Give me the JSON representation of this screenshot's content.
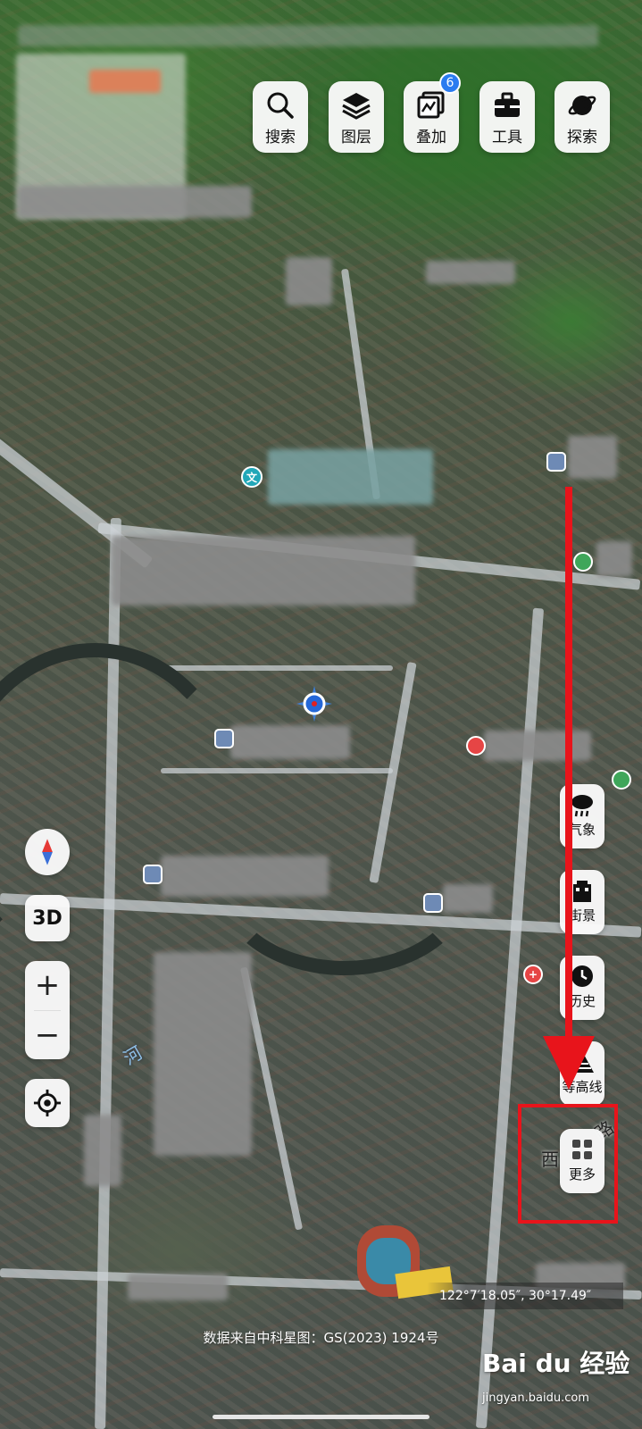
{
  "toolbar": {
    "search_label": "搜索",
    "layers_label": "图层",
    "overlay_label": "叠加",
    "overlay_badge": "6",
    "tools_label": "工具",
    "explore_label": "探索"
  },
  "left_controls": {
    "three_d_label": "3D",
    "zoom_in_label": "+",
    "zoom_out_label": "−"
  },
  "right_controls": {
    "weather_label": "气象",
    "street_view_label": "街景",
    "history_label": "历史",
    "contour_label": "等高线",
    "more_label": "更多"
  },
  "map": {
    "poi_edu_glyph": "文",
    "river_label": "河",
    "road_label_1": "西",
    "road_label_2": "路",
    "coordinates": "122°7′18.05″, 30°17.49″",
    "attribution": "数据来自中科星图：GS(2023) 1924号"
  },
  "watermark": {
    "brand": "Bai du 经验",
    "url": "jingyan.baidu.com"
  },
  "colors": {
    "accent_red": "#e8141b",
    "badge_blue": "#2b7cf0"
  }
}
